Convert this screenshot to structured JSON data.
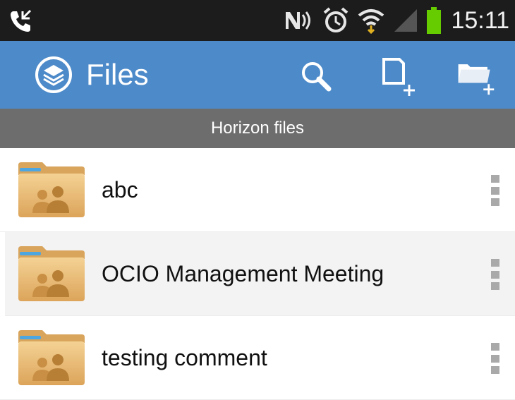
{
  "status_bar": {
    "time": "15:11",
    "icons": [
      "phone-call-icon",
      "nfc-icon",
      "alarm-icon",
      "wifi-icon",
      "signal-icon",
      "battery-icon"
    ],
    "battery_color": "#66cc00"
  },
  "app_bar": {
    "title": "Files",
    "logo_icon": "horizon-layers-icon",
    "actions": [
      "search-icon",
      "new-file-icon",
      "new-folder-icon"
    ],
    "color": "#4d8ac9"
  },
  "section": {
    "title": "Horizon files"
  },
  "files": [
    {
      "name": "abc",
      "icon": "shared-folder-icon"
    },
    {
      "name": "OCIO Management Meeting",
      "icon": "shared-folder-icon"
    },
    {
      "name": "testing comment",
      "icon": "shared-folder-icon"
    }
  ]
}
